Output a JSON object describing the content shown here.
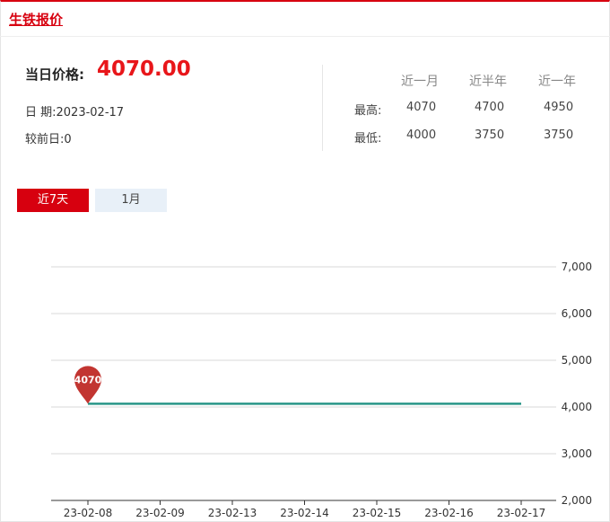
{
  "header": {
    "title": "生铁报价"
  },
  "summary": {
    "price_label": "当日价格:",
    "price_value": "4070.00",
    "date_label": "日 期:",
    "date_value": "2023-02-17",
    "change_label": "较前日:",
    "change_value": "0"
  },
  "stats": {
    "columns": [
      "近一月",
      "近半年",
      "近一年"
    ],
    "rows": [
      {
        "label": "最高:",
        "values": [
          "4070",
          "4700",
          "4950"
        ]
      },
      {
        "label": "最低:",
        "values": [
          "4000",
          "3750",
          "3750"
        ]
      }
    ]
  },
  "tabs": [
    {
      "label": "近7天",
      "active": true
    },
    {
      "label": "1月",
      "active": false
    }
  ],
  "colors": {
    "accent": "#d7000f",
    "price": "#e8161a",
    "line": "#2a9688",
    "marker": "#c23531",
    "tab_inactive_bg": "#e8f0f8"
  },
  "chart_data": {
    "type": "line",
    "categories": [
      "23-02-08",
      "23-02-09",
      "23-02-13",
      "23-02-14",
      "23-02-15",
      "23-02-16",
      "23-02-17"
    ],
    "series": [
      {
        "values": [
          4070,
          4070,
          4070,
          4070,
          4070,
          4070,
          4070
        ]
      }
    ],
    "ylim": [
      2000,
      7000
    ],
    "yticks": [
      2000,
      3000,
      4000,
      5000,
      6000,
      7000
    ],
    "ytick_labels": [
      "2,000",
      "3,000",
      "4,000",
      "5,000",
      "6,000",
      "7,000"
    ],
    "y_axis_position": "right",
    "grid": true,
    "annotation": {
      "category": "23-02-08",
      "value": 4070,
      "text": "4070"
    }
  }
}
